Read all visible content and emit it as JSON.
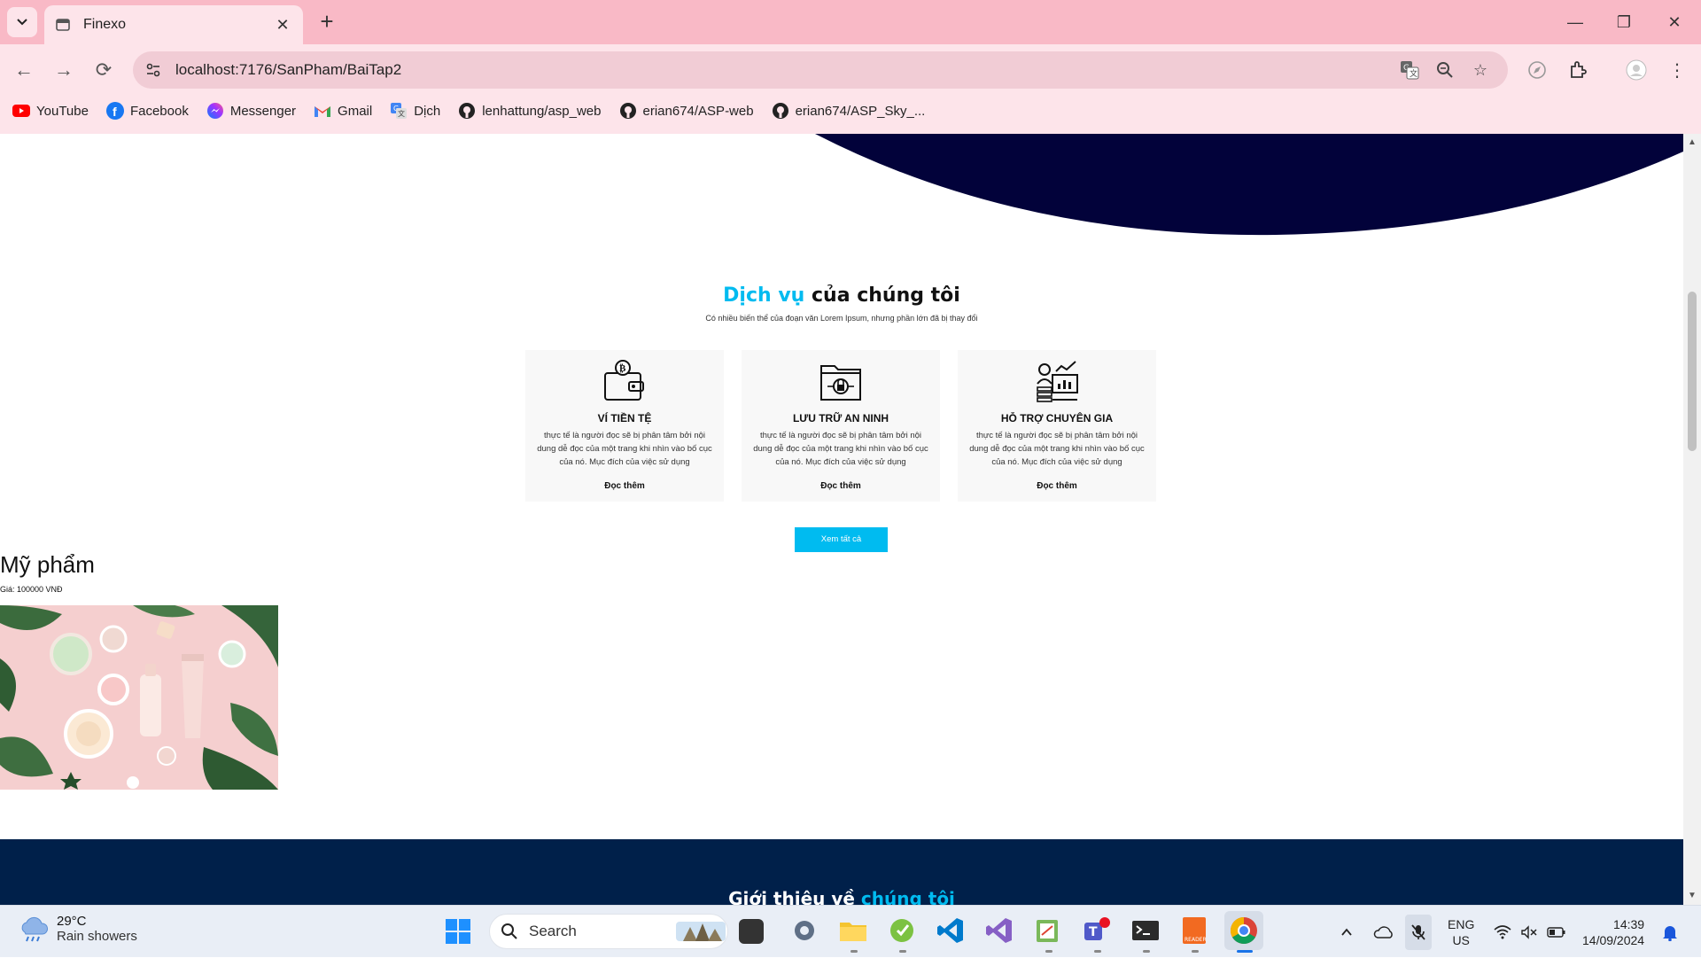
{
  "browser": {
    "tab_title": "Finexo",
    "url": "localhost:7176/SanPham/BaiTap2",
    "bookmarks": [
      {
        "label": "YouTube",
        "icon": "youtube-icon"
      },
      {
        "label": "Facebook",
        "icon": "facebook-icon"
      },
      {
        "label": "Messenger",
        "icon": "messenger-icon"
      },
      {
        "label": "Gmail",
        "icon": "gmail-icon"
      },
      {
        "label": "Dịch",
        "icon": "translate-icon"
      },
      {
        "label": "lenhattung/asp_web",
        "icon": "github-icon"
      },
      {
        "label": "erian674/ASP-web",
        "icon": "github-icon"
      },
      {
        "label": "erian674/ASP_Sky_...",
        "icon": "github-icon"
      }
    ]
  },
  "services": {
    "title_highlight": "Dịch vụ",
    "title_rest": " của chúng tôi",
    "subtitle": "Có nhiều biến thể của đoạn văn Lorem Ipsum, nhưng phần lớn đã bị thay đổi",
    "cards": [
      {
        "icon": "wallet-bitcoin-icon",
        "title": "VÍ TIỀN TỆ",
        "text": "thực tế là người đọc sẽ bị phân tâm bởi nội dung dễ đọc của một trang khi nhìn vào bố cục của nó. Mục đích của việc sử dụng",
        "link": "Đọc thêm"
      },
      {
        "icon": "secure-storage-icon",
        "title": "LƯU TRỮ AN NINH",
        "text": "thực tế là người đọc sẽ bị phân tâm bởi nội dung dễ đọc của một trang khi nhìn vào bố cục của nó. Mục đích của việc sử dụng",
        "link": "Đọc thêm"
      },
      {
        "icon": "expert-support-icon",
        "title": "HỖ TRỢ CHUYÊN GIA",
        "text": "thực tế là người đọc sẽ bị phân tâm bởi nội dung dễ đọc của một trang khi nhìn vào bố cục của nó. Mục đích của việc sử dụng",
        "link": "Đọc thêm"
      }
    ],
    "view_all": "Xem tất cả"
  },
  "product": {
    "name": "Mỹ phẩm",
    "price": "Giá: 100000 VNĐ"
  },
  "about": {
    "title_rest": "Giới thiệu về ",
    "title_highlight": "chúng tôi"
  },
  "taskbar": {
    "weather_temp": "29°C",
    "weather_desc": "Rain showers",
    "search_label": "Search",
    "lang_top": "ENG",
    "lang_bottom": "US",
    "time": "14:39",
    "date": "14/09/2024"
  },
  "colors": {
    "accent": "#00bbf0",
    "hero_navy": "#02023a",
    "about_navy": "#00204a",
    "tabstrip": "#f9b9c6",
    "toolbar": "#fde4ea"
  }
}
